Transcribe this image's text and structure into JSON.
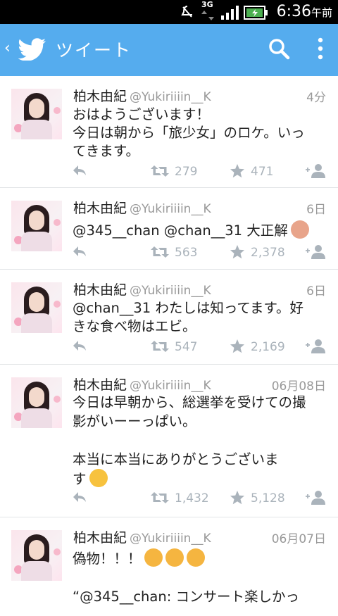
{
  "status_bar": {
    "network": "3G",
    "time": "6:36",
    "ampm": "午前"
  },
  "app_bar": {
    "back_icon": "chevron-left-icon",
    "logo_icon": "twitter-bird-icon",
    "title": "ツイート",
    "search_icon": "search-icon",
    "menu_icon": "more-vert-icon"
  },
  "colors": {
    "brand": "#55acee",
    "muted": "#999999",
    "action": "#aab3bb",
    "text": "#222222"
  },
  "tweets": [
    {
      "name": "柏木由紀",
      "handle": "@Yukiriiiin__K",
      "time": "4分",
      "lines": [
        "おはようございます！",
        "今日は朝から「旅少女」のロケ。いっ",
        "てきます。"
      ],
      "retweets": "279",
      "favorites": "471"
    },
    {
      "name": "柏木由紀",
      "handle": "@Yukiriiiin__K",
      "time": "6日",
      "lines": [
        "@345__chan @chan__31 大正解"
      ],
      "retweets": "563",
      "favorites": "2,378"
    },
    {
      "name": "柏木由紀",
      "handle": "@Yukiriiiin__K",
      "time": "6日",
      "lines": [
        "@chan__31 わたしは知ってます。好",
        "きな食べ物はエビ。"
      ],
      "retweets": "547",
      "favorites": "2,169"
    },
    {
      "name": "柏木由紀",
      "handle": "@Yukiriiiin__K",
      "time": "06月08日",
      "lines": [
        "今日は早朝から、総選挙を受けての撮",
        "影がいーーっぱい。",
        "",
        "本当に本当にありがとうございま",
        "す"
      ],
      "retweets": "1,432",
      "favorites": "5,128"
    },
    {
      "name": "柏木由紀",
      "handle": "@Yukiriiiin__K",
      "time": "06月07日",
      "lines": [
        "偽物！！！",
        "",
        "“@345__chan: コンサート楽しかっ"
      ],
      "retweets": "",
      "favorites": ""
    }
  ]
}
